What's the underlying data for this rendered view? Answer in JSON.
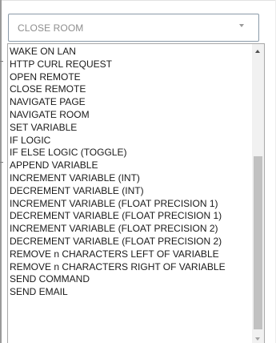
{
  "select": {
    "value": "CLOSE ROOM"
  },
  "listbox": {
    "options": [
      "WAKE ON LAN",
      "HTTP CURL REQUEST",
      "OPEN REMOTE",
      "CLOSE REMOTE",
      "NAVIGATE PAGE",
      "NAVIGATE ROOM",
      "SET VARIABLE",
      "IF LOGIC",
      "IF ELSE LOGIC (TOGGLE)",
      "APPEND VARIABLE",
      "INCREMENT VARIABLE (INT)",
      "DECREMENT VARIABLE (INT)",
      "INCREMENT VARIABLE (FLOAT PRECISION 1)",
      "DECREMENT VARIABLE (FLOAT PRECISION 1)",
      "INCREMENT VARIABLE (FLOAT PRECISION 2)",
      "DECREMENT VARIABLE (FLOAT PRECISION 2)",
      "REMOVE n CHARACTERS LEFT OF VARIABLE",
      "REMOVE n CHARACTERS RIGHT OF VARIABLE",
      "SEND COMMAND",
      "SEND EMAIL"
    ]
  },
  "icons": {
    "select_caret": "chevron-down-icon",
    "scroll_up": "scroll-up-arrow-icon",
    "scroll_down": "scroll-down-arrow-icon"
  },
  "colors": {
    "select_border": "#8a9aa8",
    "select_text": "#8e8e8e",
    "option_text": "#1a1a1a",
    "scrollbar_track": "#f1f1f1",
    "scrollbar_thumb": "#c1c1c1"
  }
}
